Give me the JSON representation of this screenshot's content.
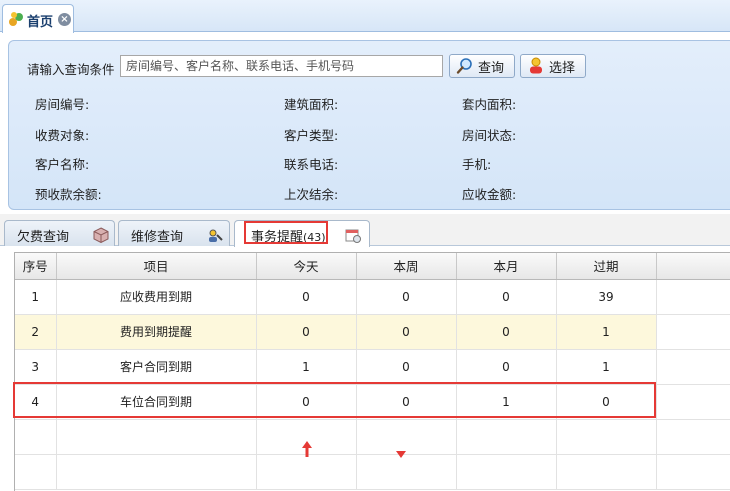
{
  "tabs": {
    "home_label": "首页",
    "close_glyph": "×"
  },
  "query": {
    "label": "请输入查询条件",
    "placeholder": "房间编号、客户名称、联系电话、手机号码",
    "query_button": "查询",
    "select_button": "选择"
  },
  "info": {
    "room_no": "房间编号:",
    "building_area": "建筑面积:",
    "inner_area": "套内面积:",
    "charge_target": "收费对象:",
    "customer_type": "客户类型:",
    "room_status": "房间状态:",
    "customer_name": "客户名称:",
    "phone": "联系电话:",
    "mobile": "手机:",
    "prepaid_balance": "预收款余额:",
    "last_settlement": "上次结余:",
    "receivable": "应收金额:"
  },
  "lower_tabs": {
    "arrears": "欠费查询",
    "repair": "维修查询",
    "events": "事务提醒",
    "events_count": "(43)"
  },
  "grid": {
    "columns": [
      "序号",
      "项目",
      "今天",
      "本周",
      "本月",
      "过期"
    ],
    "rows": [
      [
        "1",
        "应收费用到期",
        "0",
        "0",
        "0",
        "39"
      ],
      [
        "2",
        "费用到期提醒",
        "0",
        "0",
        "0",
        "1"
      ],
      [
        "3",
        "客户合同到期",
        "1",
        "0",
        "0",
        "1"
      ],
      [
        "4",
        "车位合同到期",
        "0",
        "0",
        "1",
        "0"
      ]
    ]
  },
  "colors": {
    "highlight": "#e53935",
    "alt_row": "#fdf8dc",
    "panel": "#dbe9f9"
  },
  "icons": [
    "home-icon",
    "close-icon",
    "search-icon",
    "user-select-icon",
    "box-icon",
    "repair-icon",
    "calendar-icon",
    "sort-up-icon",
    "sort-down-icon"
  ]
}
